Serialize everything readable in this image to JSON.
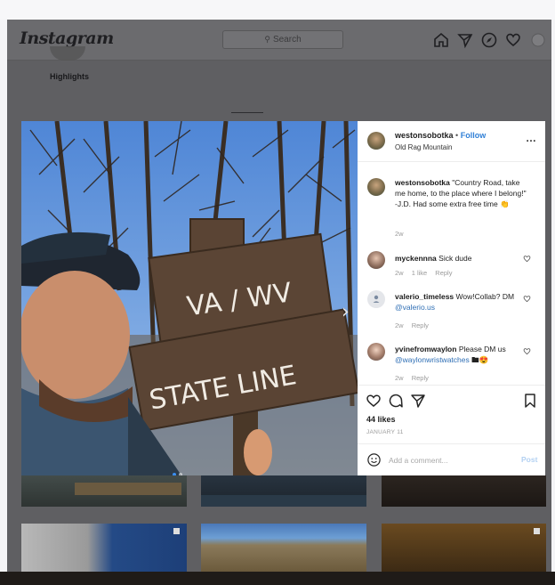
{
  "header": {
    "logo": "Instagram",
    "search_placeholder": "Search",
    "nav_icons": [
      "home-icon",
      "direct-send-icon",
      "explore-compass-icon",
      "activity-heart-icon",
      "profile-avatar-icon"
    ]
  },
  "profile": {
    "highlights_label": "Highlights"
  },
  "post": {
    "username": "westonsobotka",
    "separator": "•",
    "follow_label": "Follow",
    "location": "Old Rag Mountain",
    "caption_user": "westonsobotka",
    "caption_text": "\"Country Road, take me home, to the place where I belong!\"",
    "caption_text_2": "-J.D. Had some extra free time",
    "caption_emoji": "👏",
    "caption_time": "2w",
    "sign_text_1": "VA / WV",
    "sign_text_2": "STATE LINE",
    "comments": [
      {
        "user": "myckennna",
        "text": "Sick dude",
        "time": "2w",
        "likes": "1 like",
        "reply": "Reply"
      },
      {
        "user": "valerio_timeless",
        "text": "Wow!Collab? DM",
        "link": "@valerio.us",
        "time": "2w",
        "reply": "Reply"
      },
      {
        "user": "yvinefromwaylon",
        "text": "Please DM us",
        "link": "@waylonwristwatches",
        "emoji": "🖿😍",
        "time": "2w",
        "reply": "Reply"
      }
    ],
    "likes": "44 likes",
    "date": "JANUARY 11",
    "add_comment_placeholder": "Add a comment...",
    "post_label": "Post"
  },
  "colors": {
    "accent": "#2f7fd6",
    "overlay": "#5f5f62",
    "panel_bg": "#ffffff"
  }
}
